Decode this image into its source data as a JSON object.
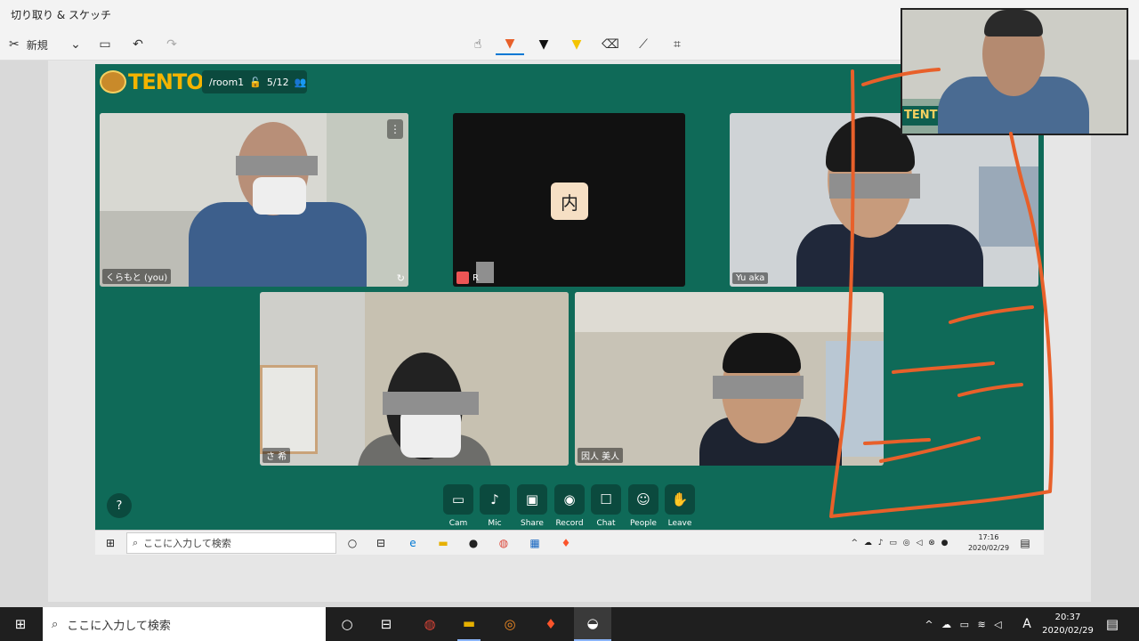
{
  "window": {
    "title": "切り取り & スケッチ"
  },
  "toolbar": {
    "new_label": "新規"
  },
  "room": {
    "path": "/room1",
    "count": "5/12"
  },
  "logo": {
    "text": "TENTO"
  },
  "tiles": [
    {
      "name": "くらもと (you)"
    },
    {
      "initial": "内",
      "name": "R"
    },
    {
      "name": "Yu        aka"
    },
    {
      "name": "さ       希"
    },
    {
      "name": "因人      美人"
    }
  ],
  "controls": [
    {
      "label": "Cam",
      "icon": "camera-icon"
    },
    {
      "label": "Mic",
      "icon": "microphone-icon"
    },
    {
      "label": "Share",
      "icon": "screen-share-icon"
    },
    {
      "label": "Record",
      "icon": "record-icon"
    },
    {
      "label": "Chat",
      "icon": "chat-icon"
    },
    {
      "label": "People",
      "icon": "people-icon"
    },
    {
      "label": "Leave",
      "icon": "hand-wave-icon"
    }
  ],
  "help": {
    "label": "?"
  },
  "inner_taskbar": {
    "search": "ここに入力して検索",
    "time": "17:16",
    "date": "2020/02/29"
  },
  "taskbar": {
    "search": "ここに入力して検索",
    "time": "20:37",
    "date": "2020/02/29",
    "ime": "A"
  },
  "colors": {
    "meeting_bg": "#0f6a58",
    "control_bg": "#0b4a3e",
    "ink": "#e8602a",
    "accent": "#0078d4"
  }
}
